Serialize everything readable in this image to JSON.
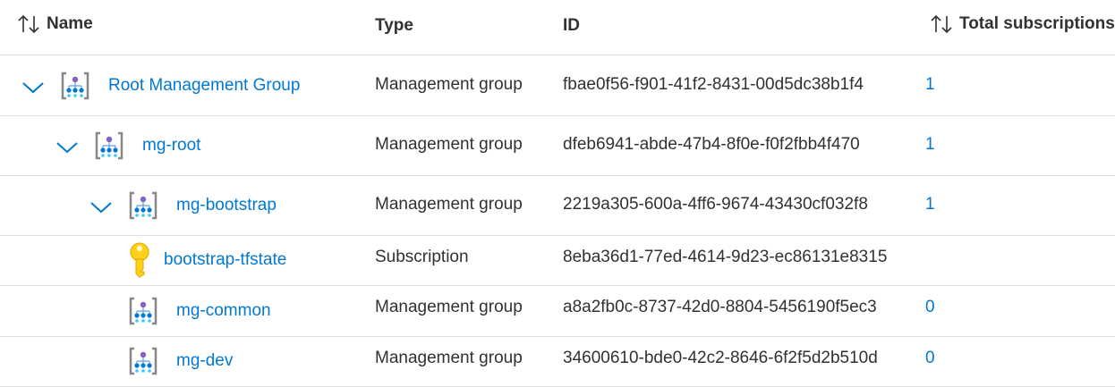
{
  "columns": {
    "name": "Name",
    "type": "Type",
    "id": "ID",
    "total": "Total subscriptions"
  },
  "rows": [
    {
      "name": "Root Management Group",
      "type": "Management group",
      "id": "fbae0f56-f901-41f2-8431-00d5dc38b1f4",
      "count": "1",
      "icon": "management-group-icon",
      "expanded": true,
      "level": 0
    },
    {
      "name": "mg-root",
      "type": "Management group",
      "id": "dfeb6941-abde-47b4-8f0e-f0f2fbb4f470",
      "count": "1",
      "icon": "management-group-icon",
      "expanded": true,
      "level": 1
    },
    {
      "name": "mg-bootstrap",
      "type": "Management group",
      "id": "2219a305-600a-4ff6-9674-43430cf032f8",
      "count": "1",
      "icon": "management-group-icon",
      "expanded": true,
      "level": 2
    },
    {
      "name": "bootstrap-tfstate",
      "type": "Subscription",
      "id": "8eba36d1-77ed-4614-9d23-ec86131e8315",
      "count": "",
      "icon": "subscription-key-icon",
      "expanded": false,
      "level": 3
    },
    {
      "name": "mg-common",
      "type": "Management group",
      "id": "a8a2fb0c-8737-42d0-8804-5456190f5ec3",
      "count": "0",
      "icon": "management-group-icon",
      "expanded": false,
      "level": 2
    },
    {
      "name": "mg-dev",
      "type": "Management group",
      "id": "34600610-bde0-42c2-8646-6f2f5d2b510d",
      "count": "0",
      "icon": "management-group-icon",
      "expanded": false,
      "level": 2
    }
  ],
  "colors": {
    "link": "#0078d4",
    "text": "#323130",
    "divider": "#e1dfdd"
  }
}
